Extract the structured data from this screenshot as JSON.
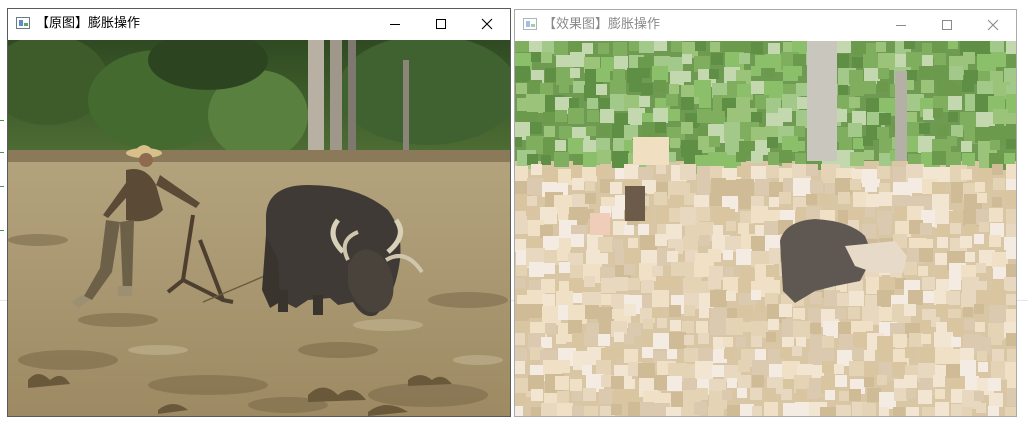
{
  "windows": [
    {
      "title": "【原图】膨胀操作",
      "state": "active",
      "image_content": "farmer-plowing-muddy-paddy-with-water-buffer-original"
    },
    {
      "title": "【效果图】膨胀操作",
      "state": "inactive",
      "image_content": "same-scene-after-dilation-blocky-bright-squares"
    }
  ],
  "controls": {
    "minimize": "minimize-icon",
    "maximize": "maximize-icon",
    "close": "close-icon"
  },
  "colors": {
    "mud": "#a28f68",
    "foliage": "#4a6b2e",
    "buffalo": "#3d3834",
    "dilated_mud": "#dcc9a8",
    "dilated_foliage": "#7fae5e",
    "active_border": "#5a5a5a",
    "inactive_title": "#8a8a8a"
  }
}
